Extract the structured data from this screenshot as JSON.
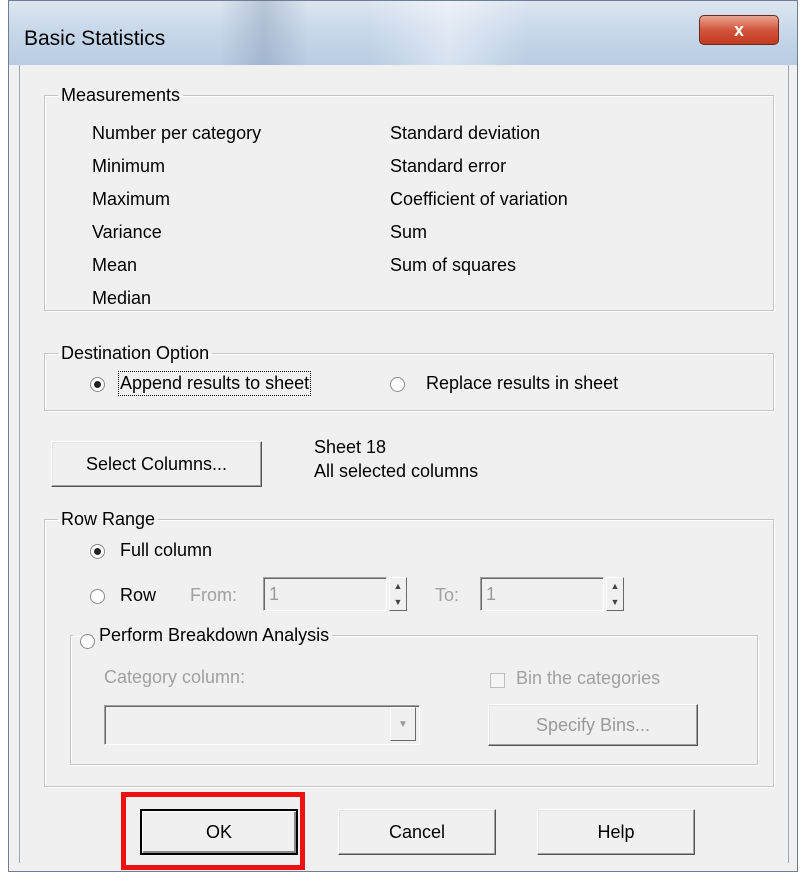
{
  "window": {
    "title": "Basic Statistics",
    "close_glyph": "x"
  },
  "measurements": {
    "legend": "Measurements",
    "col1": [
      "Number per category",
      "Minimum",
      "Maximum",
      "Variance",
      "Mean",
      "Median"
    ],
    "col2": [
      "Standard deviation",
      "Standard error",
      "Coefficient of variation",
      "Sum",
      "Sum of squares"
    ]
  },
  "destination": {
    "legend": "Destination Option",
    "append_label": "Append results to sheet",
    "replace_label": "Replace results in sheet",
    "selected": "append"
  },
  "columns": {
    "button_label": "Select Columns...",
    "sheet": "Sheet 18",
    "selection": "All selected columns"
  },
  "row_range": {
    "legend": "Row Range",
    "full_column_label": "Full column",
    "row_label": "Row",
    "from_label": "From:",
    "from_value": "1",
    "to_label": "To:",
    "to_value": "1",
    "selected": "full_column"
  },
  "breakdown": {
    "legend": "Perform Breakdown Analysis",
    "category_label": "Category column:",
    "category_value": "",
    "bin_label": "Bin the categories",
    "specify_bins_label": "Specify Bins..."
  },
  "buttons": {
    "ok": "OK",
    "cancel": "Cancel",
    "help": "Help"
  },
  "colors": {
    "highlight": "#ee1111",
    "titlebar": "#c9d8ea",
    "close": "#d2553b"
  }
}
